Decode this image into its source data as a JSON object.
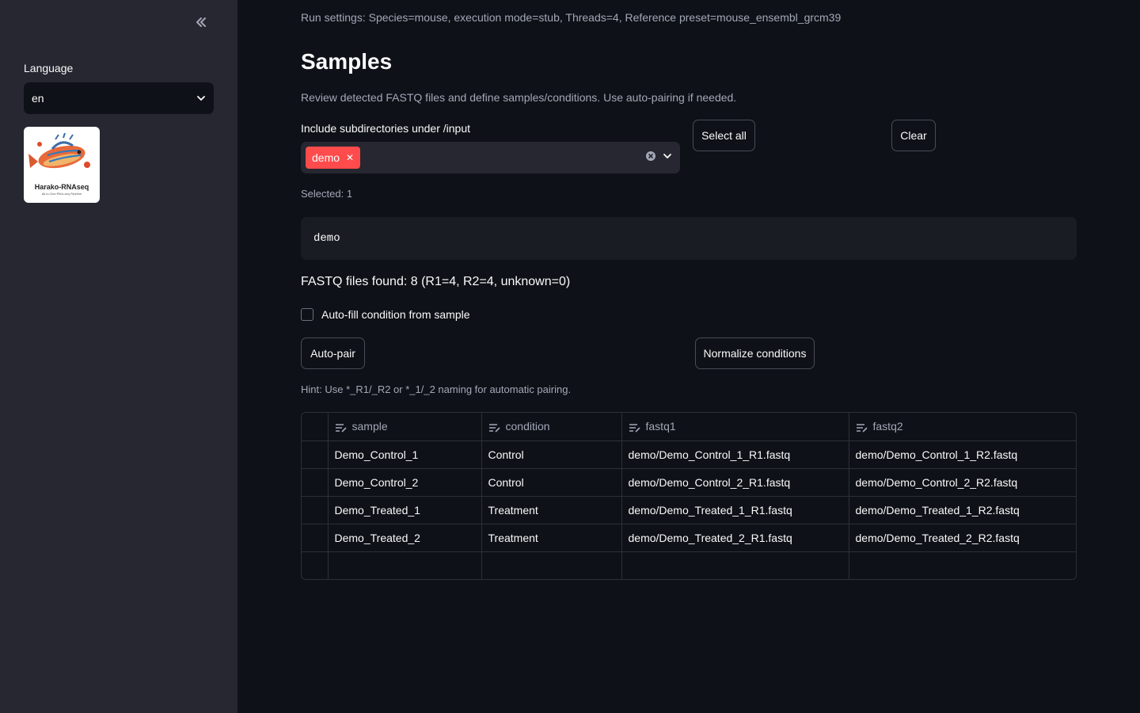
{
  "sidebar": {
    "collapse_icon": "double-chevron-left-icon",
    "language_label": "Language",
    "language_value": "en",
    "logo": {
      "name": "Harako-RNAseq",
      "tagline": "All-in-One RNA-seq Pipeline"
    }
  },
  "main": {
    "run_settings": "Run settings: Species=mouse, execution mode=stub, Threads=4, Reference preset=mouse_ensembl_grcm39",
    "title": "Samples",
    "caption": "Review detected FASTQ files and define samples/conditions. Use auto-pairing if needed.",
    "subdir_label": "Include subdirectories under /input",
    "subdir_selected_tag": "demo",
    "select_all_label": "Select all",
    "clear_label": "Clear",
    "selected_count": "Selected: 1",
    "selected_code": "demo",
    "fastq_found": "FASTQ files found: 8 (R1=4, R2=4, unknown=0)",
    "autofill_label": "Auto-fill condition from sample",
    "autofill_checked": false,
    "autopair_label": "Auto-pair",
    "normalize_label": "Normalize conditions",
    "hint": "Hint: Use *_R1/_R2 or *_1/_2 naming for automatic pairing."
  },
  "table": {
    "columns": [
      "sample",
      "condition",
      "fastq1",
      "fastq2"
    ],
    "rows": [
      [
        "Demo_Control_1",
        "Control",
        "demo/Demo_Control_1_R1.fastq",
        "demo/Demo_Control_1_R2.fastq"
      ],
      [
        "Demo_Control_2",
        "Control",
        "demo/Demo_Control_2_R1.fastq",
        "demo/Demo_Control_2_R2.fastq"
      ],
      [
        "Demo_Treated_1",
        "Treatment",
        "demo/Demo_Treated_1_R1.fastq",
        "demo/Demo_Treated_1_R2.fastq"
      ],
      [
        "Demo_Treated_2",
        "Treatment",
        "demo/Demo_Treated_2_R1.fastq",
        "demo/Demo_Treated_2_R2.fastq"
      ]
    ]
  },
  "colors": {
    "accent": "#ff4b4b",
    "background": "#0e1117",
    "sidebar": "#262730"
  }
}
